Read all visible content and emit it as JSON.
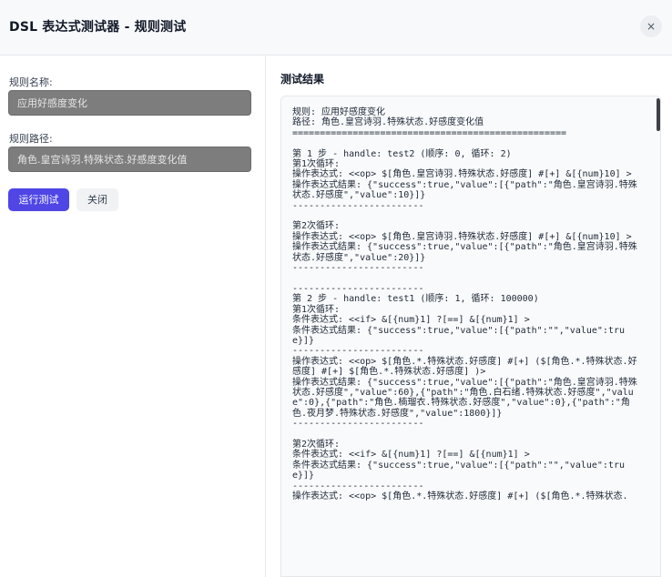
{
  "header": {
    "title": "DSL 表达式测试器 - 规则测试",
    "close_glyph": "×"
  },
  "form": {
    "name_label": "规则名称:",
    "name_value": "应用好感度变化",
    "path_label": "规则路径:",
    "path_value": "角色.皇宫诗羽.特殊状态.好感度变化值",
    "run_label": "运行测试",
    "close_label": "关闭"
  },
  "results": {
    "title": "测试结果",
    "lines": [
      "规则: 应用好感度变化",
      "路径: 角色.皇宫诗羽.特殊状态.好感度变化值",
      "==================================================",
      "",
      "第 1 步 - handle: test2 (顺序: 0, 循环: 2)",
      "第1次循环:",
      "操作表达式: <<op> $[角色.皇宫诗羽.特殊状态.好感度] #[+] &[{num}10] >",
      "操作表达式结果: {\"success\":true,\"value\":[{\"path\":\"角色.皇宫诗羽.特殊状态.好感度\",\"value\":10}]}",
      "------------------------",
      "",
      "第2次循环:",
      "操作表达式: <<op> $[角色.皇宫诗羽.特殊状态.好感度] #[+] &[{num}10] >",
      "操作表达式结果: {\"success\":true,\"value\":[{\"path\":\"角色.皇宫诗羽.特殊状态.好感度\",\"value\":20}]}",
      "------------------------",
      "",
      "------------------------",
      "第 2 步 - handle: test1 (顺序: 1, 循环: 100000)",
      "第1次循环:",
      "条件表达式: <<if> &[{num}1] ?[==] &[{num}1] >",
      "条件表达式结果: {\"success\":true,\"value\":[{\"path\":\"\",\"value\":true}]}",
      "------------------------",
      "操作表达式: <<op> $[角色.*.特殊状态.好感度] #[+] ($[角色.*.特殊状态.好感度] #[+] $[角色.*.特殊状态.好感度] )>",
      "操作表达式结果: {\"success\":true,\"value\":[{\"path\":\"角色.皇宫诗羽.特殊状态.好感度\",\"value\":60},{\"path\":\"角色.白石绪.特殊状态.好感度\",\"value\":0},{\"path\":\"角色.楠瑠衣.特殊状态.好感度\",\"value\":0},{\"path\":\"角色.夜月梦.特殊状态.好感度\",\"value\":1800}]}",
      "------------------------",
      "",
      "第2次循环:",
      "条件表达式: <<if> &[{num}1] ?[==] &[{num}1] >",
      "条件表达式结果: {\"success\":true,\"value\":[{\"path\":\"\",\"value\":true}]}",
      "------------------------",
      "操作表达式: <<op> $[角色.*.特殊状态.好感度] #[+] ($[角色.*.特殊状态."
    ]
  }
}
